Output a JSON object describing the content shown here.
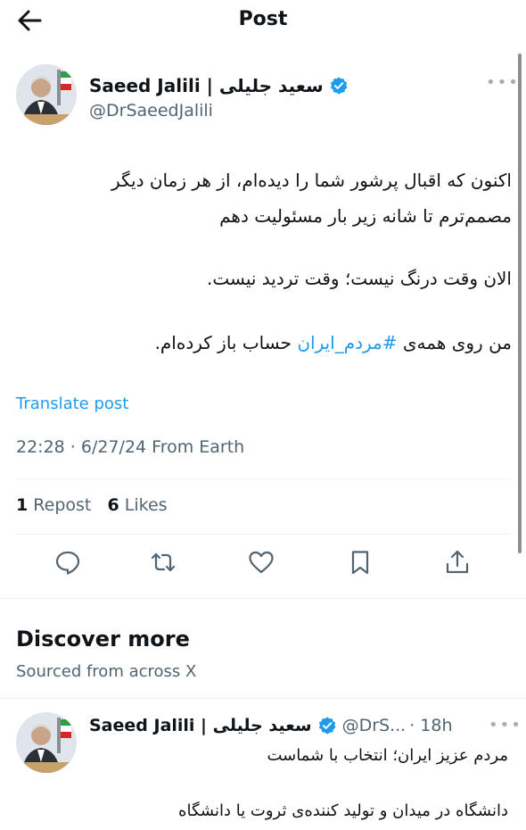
{
  "header": {
    "title": "Post"
  },
  "post": {
    "author_name": "Saeed Jalili | سعید جلیلی",
    "handle": "@DrSaeedJalili",
    "lines": [
      "اکنون که اقبال پرشور شما را دیده‌ام، از هر زمان دیگر",
      "مصمم‌ترم تا شانه زیر بار مسئولیت دهم",
      "الان وقت درنگ نیست؛ وقت تردید نیست.",
      "من روی همه‌ی",
      "#مردم_ایران",
      "حساب باز کرده‌ام."
    ],
    "translate": "Translate post",
    "meta": "22:28 · 6/27/24 From Earth",
    "repost_count": "1",
    "repost_label": "Repost",
    "likes_count": "6",
    "likes_label": "Likes"
  },
  "discover": {
    "title": "Discover more",
    "subtitle": "Sourced from across X",
    "card": {
      "author_name": "Saeed Jalili | سعید جلیلی",
      "handle": "@DrS...",
      "time": "· 18h",
      "lines": [
        "مردم عزیز ایران؛ انتخاب با شماست",
        "دانشگاه در میدان و تولید کننده‌ی ثروت یا دانشگاه"
      ]
    }
  },
  "icons": [
    "back-arrow-icon",
    "verified-badge-icon",
    "more-icon",
    "reply-icon",
    "repost-icon",
    "like-icon",
    "bookmark-icon",
    "share-icon"
  ],
  "colors": {
    "accent": "#1d9bf0",
    "muted": "#536471",
    "text": "#0f1419"
  }
}
